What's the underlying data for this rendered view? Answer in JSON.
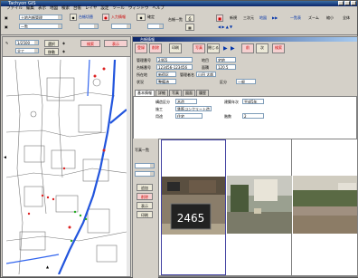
{
  "window": {
    "title": "Tachyon GIS"
  },
  "menu": [
    "ファイル",
    "編集",
    "表示",
    "地図",
    "検索",
    "台帳",
    "レイヤ",
    "設定",
    "ツール",
    "ウィンドウ",
    "ヘルプ"
  ],
  "toolbar": {
    "area_combo": "土地台帳管理",
    "layer_combo": "一覧",
    "label_a": "台帳切替",
    "label_b": "入力情報",
    "label_c": "確定",
    "label_d": "台帳一覧",
    "label_e": "印刷",
    "label_f": "写真",
    "label_g": "新規",
    "label_h": "三次元",
    "label_i": "地図",
    "right_labels": [
      "一覧表",
      "ズーム",
      "縮小",
      "全体"
    ]
  },
  "map": {
    "scale_combo": "1/2500",
    "layer_combo": "全て",
    "btn_a": "選択",
    "btn_b": "移動",
    "btn_c": "検索",
    "btn_d": "表示"
  },
  "panel": {
    "title": "台帳情報",
    "buttons": [
      "登録",
      "削除",
      "印刷",
      "写真",
      "閉じる",
      "前",
      "次",
      "検索"
    ],
    "fields": [
      {
        "label": "管理番号",
        "value": "2465"
      },
      {
        "label": "台帳番号",
        "value": "123456-123456"
      },
      {
        "label": "所在地",
        "value": "新宿区"
      },
      {
        "label": "状況",
        "value": "整備済"
      },
      {
        "label": "管理者名",
        "value": "山田 太郎"
      }
    ],
    "right_fields": [
      {
        "label": "地目",
        "value": "宅地"
      },
      {
        "label": "面積",
        "value": "120.5"
      },
      {
        "label": "区分",
        "value": "一般"
      }
    ],
    "tabs": [
      "基本情報",
      "詳細",
      "写真",
      "図面",
      "履歴"
    ],
    "detail": [
      {
        "label": "構造区分",
        "value": "木造"
      },
      {
        "label": "施工",
        "value": "鉄筋コンクリート造"
      },
      {
        "label": "用途",
        "value": "住宅"
      }
    ],
    "detail_right": [
      {
        "label": "建築年次",
        "value": "平成5年"
      },
      {
        "label": "階数",
        "value": "2"
      }
    ],
    "photo_number": "2465",
    "side_combo": "写真一覧",
    "side_buttons": [
      "追加",
      "削除",
      "表示",
      "印刷"
    ]
  }
}
